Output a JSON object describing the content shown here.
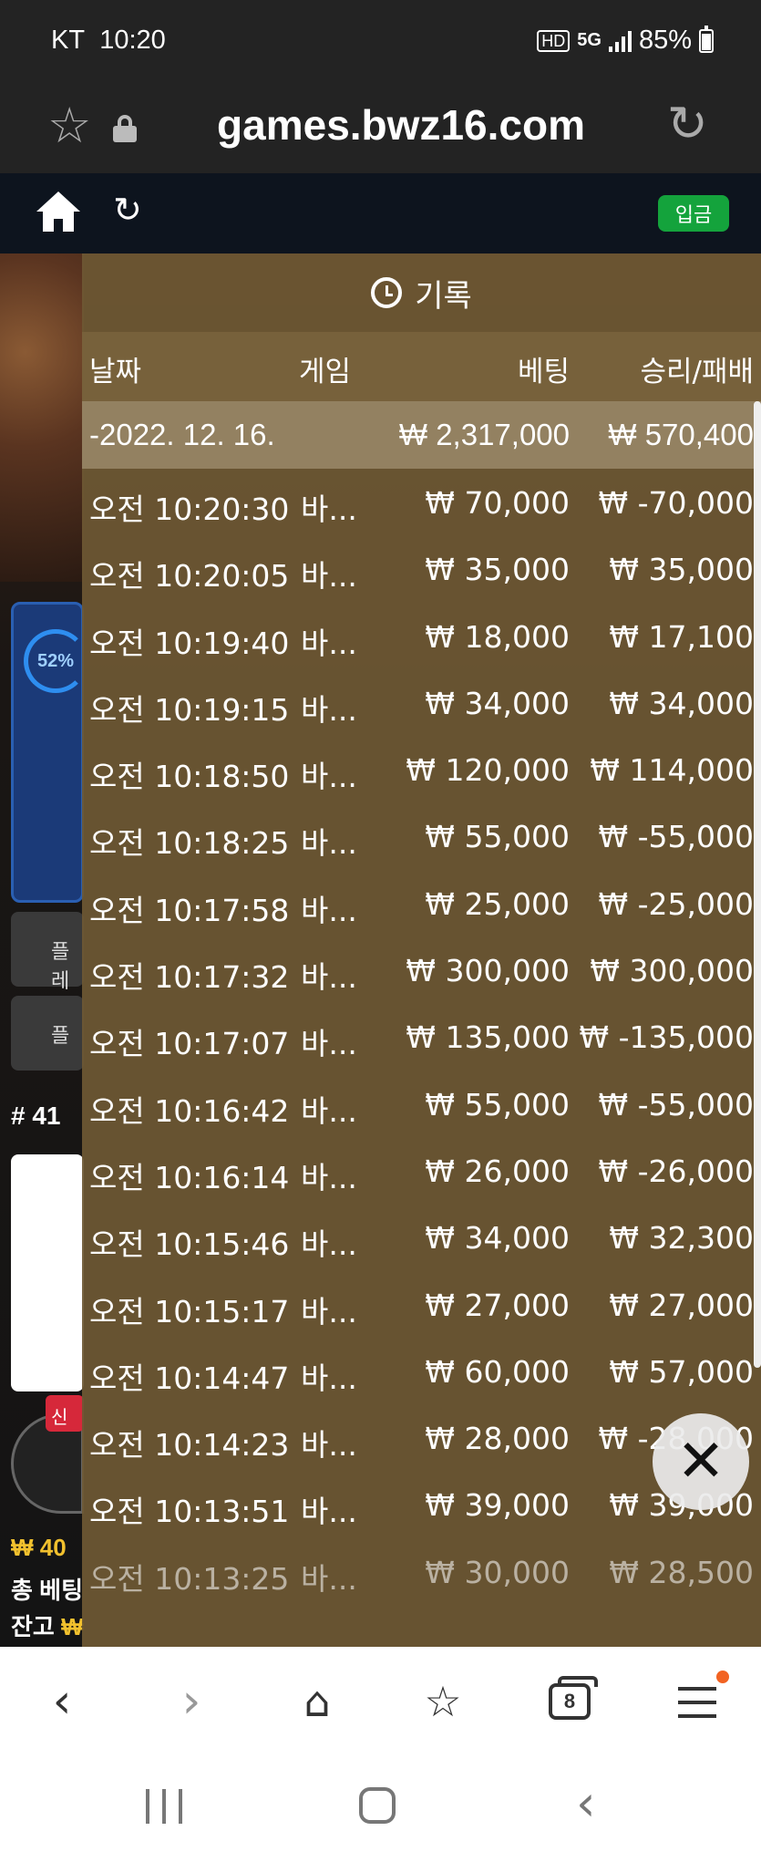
{
  "status_bar": {
    "carrier": "KT",
    "time": "10:20",
    "hd_icon": "HD",
    "network": "5G",
    "battery": "85%"
  },
  "address_bar": {
    "url": "games.bwz16.com"
  },
  "site_nav": {
    "deposit_label": "입금"
  },
  "game_bg": {
    "percent": "52%",
    "btn1": "플레",
    "btn2": "플",
    "round": "# 41",
    "new_tag": "신",
    "money": "₩ 40",
    "total_bet": "총 베팅",
    "balance_label": "잔고",
    "balance_value": "₩"
  },
  "history": {
    "title": "기록",
    "columns": {
      "date": "날짜",
      "game": "게임",
      "bet": "베팅",
      "winloss": "승리/패배"
    },
    "summary": {
      "date": "-2022. 12. 16.",
      "bet": "₩ 2,317,000",
      "winloss": "₩ 570,400"
    },
    "rows": [
      {
        "time": "오전 10:20:30",
        "game": "바...",
        "bet": "₩ 70,000",
        "result": "₩ -70,000"
      },
      {
        "time": "오전 10:20:05",
        "game": "바...",
        "bet": "₩ 35,000",
        "result": "₩ 35,000"
      },
      {
        "time": "오전 10:19:40",
        "game": "바...",
        "bet": "₩ 18,000",
        "result": "₩ 17,100"
      },
      {
        "time": "오전 10:19:15",
        "game": "바...",
        "bet": "₩ 34,000",
        "result": "₩ 34,000"
      },
      {
        "time": "오전 10:18:50",
        "game": "바...",
        "bet": "₩ 120,000",
        "result": "₩ 114,000"
      },
      {
        "time": "오전 10:18:25",
        "game": "바...",
        "bet": "₩ 55,000",
        "result": "₩ -55,000"
      },
      {
        "time": "오전 10:17:58",
        "game": "바...",
        "bet": "₩ 25,000",
        "result": "₩ -25,000"
      },
      {
        "time": "오전 10:17:32",
        "game": "바...",
        "bet": "₩ 300,000",
        "result": "₩ 300,000"
      },
      {
        "time": "오전 10:17:07",
        "game": "바...",
        "bet": "₩ 135,000",
        "result": "₩ -135,000"
      },
      {
        "time": "오전 10:16:42",
        "game": "바...",
        "bet": "₩ 55,000",
        "result": "₩ -55,000"
      },
      {
        "time": "오전 10:16:14",
        "game": "바...",
        "bet": "₩ 26,000",
        "result": "₩ -26,000"
      },
      {
        "time": "오전 10:15:46",
        "game": "바...",
        "bet": "₩ 34,000",
        "result": "₩ 32,300"
      },
      {
        "time": "오전 10:15:17",
        "game": "바...",
        "bet": "₩ 27,000",
        "result": "₩ 27,000"
      },
      {
        "time": "오전 10:14:47",
        "game": "바...",
        "bet": "₩ 60,000",
        "result": "₩ 57,000"
      },
      {
        "time": "오전 10:14:23",
        "game": "바...",
        "bet": "₩ 28,000",
        "result": "₩ -28,000"
      },
      {
        "time": "오전 10:13:51",
        "game": "바...",
        "bet": "₩ 39,000",
        "result": "₩ 39,000"
      },
      {
        "time": "오전 10:13:25",
        "game": "바...",
        "bet": "₩ 30,000",
        "result": "₩ 28,500"
      }
    ]
  },
  "toolbar": {
    "tab_count": "8"
  }
}
